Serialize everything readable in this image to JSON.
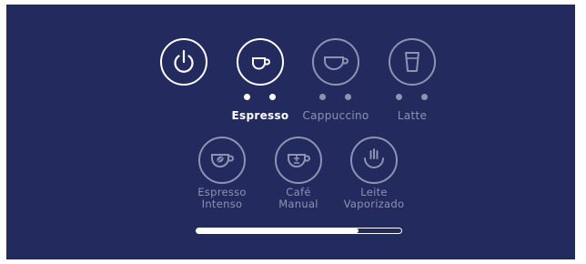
{
  "colors": {
    "panel_background": "#222a5e",
    "active": "#ffffff",
    "inactive": "#8e93b2"
  },
  "top_row": {
    "power": {
      "icon": "power-icon"
    },
    "drinks": [
      {
        "label": "Espresso",
        "icon": "small-cup-icon",
        "selected": true
      },
      {
        "label": "Cappuccino",
        "icon": "wide-cup-icon",
        "selected": false
      },
      {
        "label": "Latte",
        "icon": "glass-icon",
        "selected": false
      }
    ]
  },
  "bottom_row": {
    "drinks": [
      {
        "line1": "Espresso",
        "line2": "Intenso",
        "icon": "coffee-bean-cup-icon"
      },
      {
        "line1": "Café",
        "line2": "Manual",
        "icon": "plus-minus-cup-icon"
      },
      {
        "line1": "Leite",
        "line2": "Vaporizado",
        "icon": "steam-icon"
      }
    ]
  },
  "progress": {
    "fraction": 0.79
  }
}
